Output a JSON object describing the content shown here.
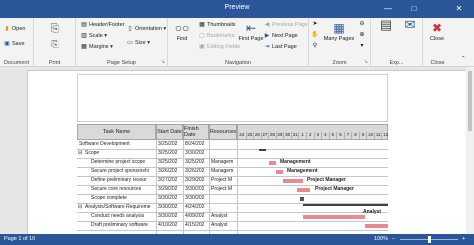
{
  "window": {
    "title": "Preview"
  },
  "ribbon": {
    "groups": {
      "document": "Document",
      "print": "Print",
      "page_setup": "Page Setup",
      "navigation": "Navigation",
      "zoom": "Zoom",
      "export": "Exp...",
      "close": "Close"
    },
    "document": {
      "open": "Open",
      "save": "Save"
    },
    "print": {
      "print": "Print",
      "quick_print": "Quick Print"
    },
    "page_setup": {
      "header_footer": "Header/Footer",
      "scale": "Scale",
      "margins": "Margins",
      "orientation": "Orientation",
      "size": "Size"
    },
    "navigation": {
      "find": "Find",
      "thumbnails": "Thumbnails",
      "bookmarks": "Bookmarks",
      "editing_fields": "Editing Fields",
      "first_page": "First Page",
      "previous_page": "Previous Page",
      "next_page": "Next Page",
      "last_page": "Last Page"
    },
    "zoom": {
      "many_pages": "Many Pages"
    },
    "close": {
      "label": "Close"
    }
  },
  "grid": {
    "headers": {
      "task_name": "Task Name",
      "start_date": "Start Date",
      "finish_date": "Finish Date",
      "resources": "Resources"
    },
    "rows": [
      {
        "name": "Software Development",
        "start": "3/25/202",
        "finish": "8/24/202",
        "resources": ""
      },
      {
        "name": "Scope",
        "start": "3/25/202",
        "finish": "3/30/202",
        "resources": ""
      },
      {
        "name": "Determine project scope",
        "start": "3/25/202",
        "finish": "3/25/202",
        "resources": "Managem"
      },
      {
        "name": "Secure project sponsorshi",
        "start": "3/26/202",
        "finish": "3/26/202",
        "resources": "Managem"
      },
      {
        "name": "Define preliminary resour",
        "start": "3/27/202",
        "finish": "3/29/202",
        "resources": "Project M"
      },
      {
        "name": "Secure core resources",
        "start": "3/29/202",
        "finish": "3/30/202",
        "resources": "Project M"
      },
      {
        "name": "Scope complete",
        "start": "3/30/202",
        "finish": "3/30/202",
        "resources": ""
      },
      {
        "name": "Analysis/Software Requireme",
        "start": "3/30/202",
        "finish": "4/24/202",
        "resources": ""
      },
      {
        "name": "Conduct needs analysis",
        "start": "3/30/202",
        "finish": "4/09/202",
        "resources": "Analyst"
      },
      {
        "name": "Draft preliminary software",
        "start": "4/10/202",
        "finish": "4/15/202",
        "resources": "Analyst"
      }
    ],
    "gantt_days": [
      "24",
      "25",
      "26",
      "27",
      "28",
      "29",
      "30",
      "31",
      "1",
      "2",
      "3",
      "4",
      "5",
      "6",
      "7",
      "8",
      "9",
      "10",
      "11",
      "12"
    ],
    "gantt_labels": {
      "management_1": "Management",
      "management_2": "Management",
      "pm_1": "Project Manager",
      "pm_2": "Project Manager",
      "analyst": "Analyst"
    }
  },
  "status": {
    "page_info": "Page 1 of 10",
    "zoom": "100%"
  }
}
